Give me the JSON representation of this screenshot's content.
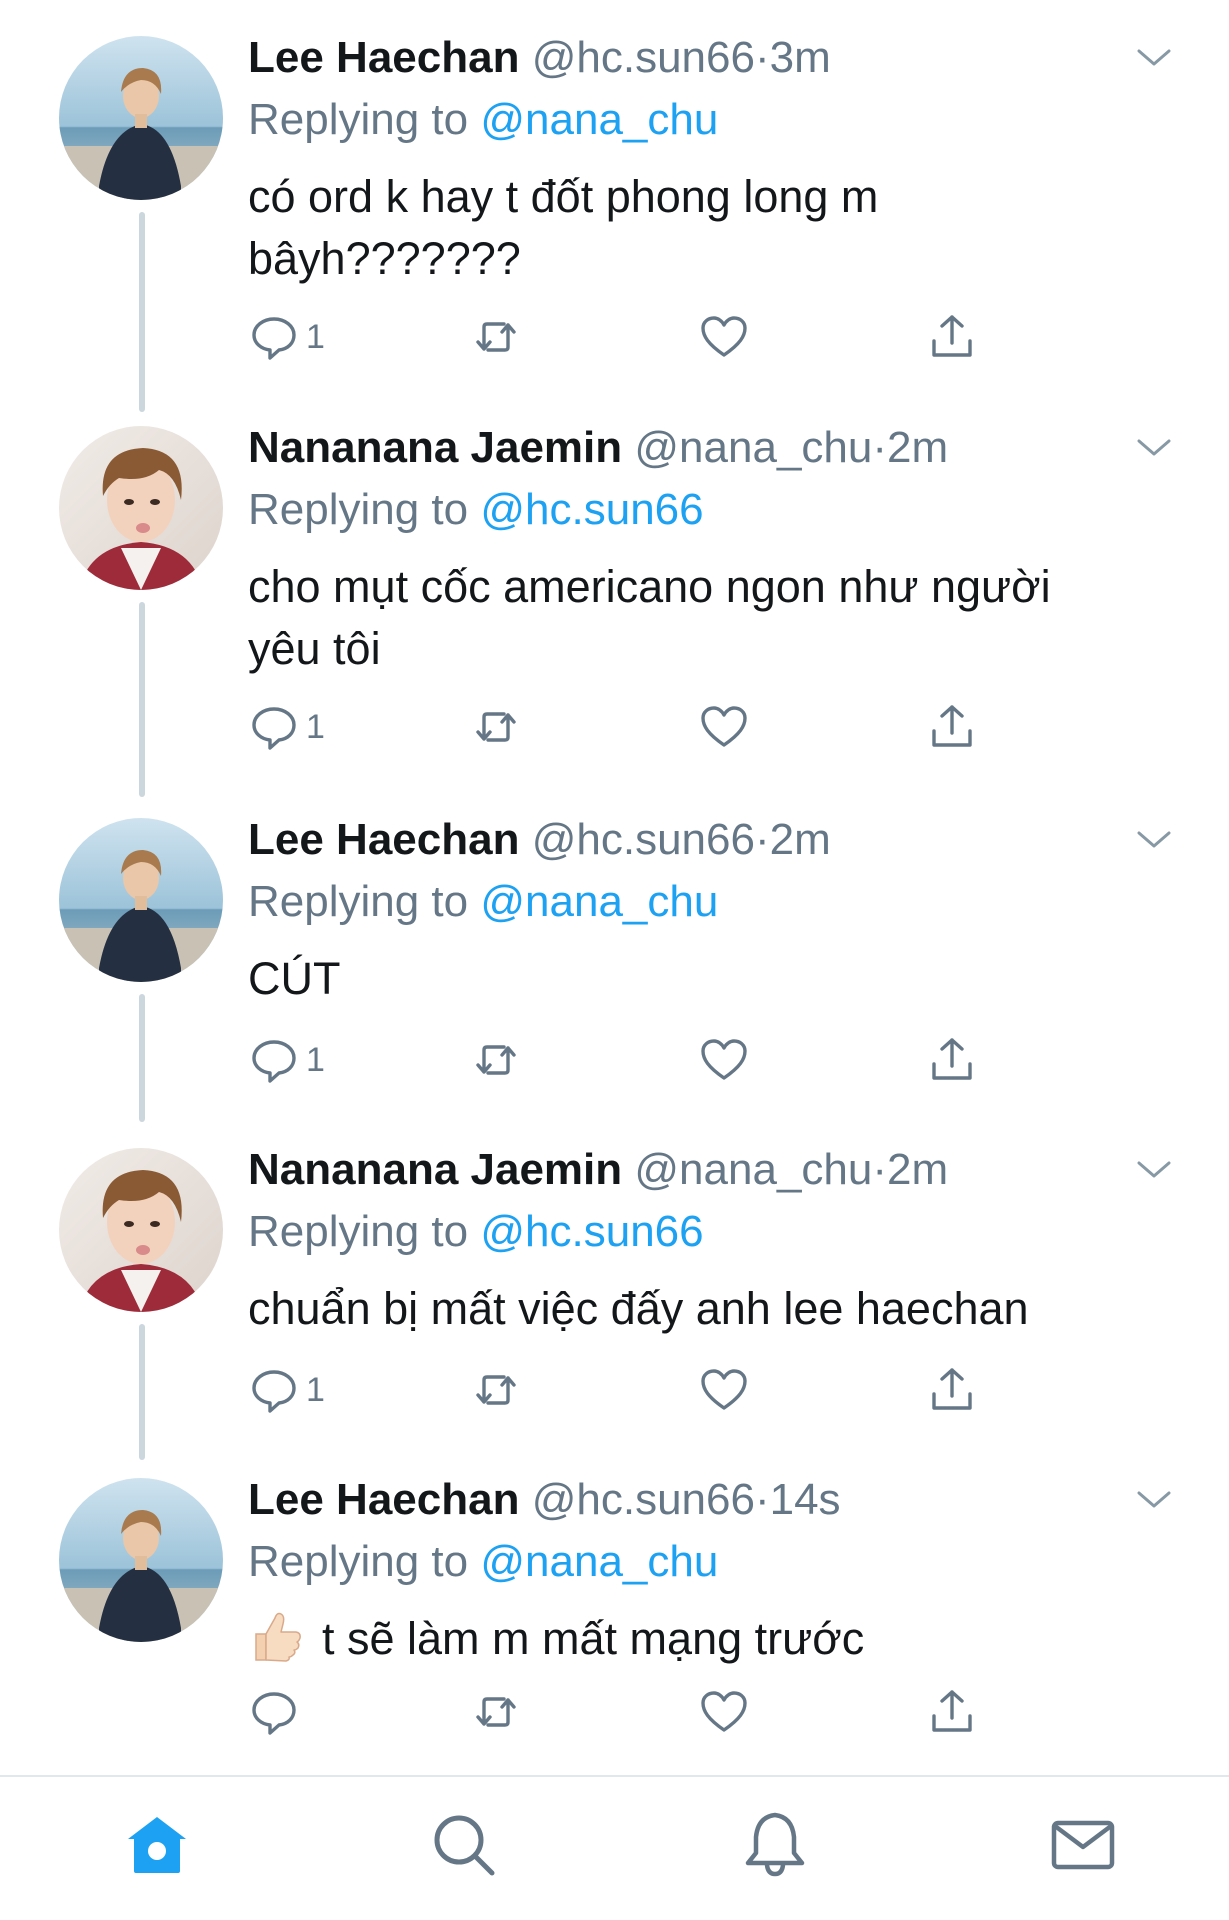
{
  "tweets": [
    {
      "name": "Lee Haechan",
      "handle": "@hc.sun66",
      "dot": "·",
      "time": "3m",
      "replying_prefix": "Replying to ",
      "replying_to": "@nana_chu",
      "text": "có ord k hay t đốt phong long m bâyh???????",
      "reply_count": "1",
      "avatar": "beach-sweater-avatar"
    },
    {
      "name": "Nananana Jaemin",
      "handle": "@nana_chu",
      "dot": "·",
      "time": "2m",
      "replying_prefix": "Replying to ",
      "replying_to": "@hc.sun66",
      "text": "cho mụt cốc americano ngon như người yêu tôi",
      "reply_count": "1",
      "avatar": "face-selfie-avatar"
    },
    {
      "name": "Lee Haechan",
      "handle": "@hc.sun66",
      "dot": "·",
      "time": "2m",
      "replying_prefix": "Replying to ",
      "replying_to": "@nana_chu",
      "text": "CÚT",
      "reply_count": "1",
      "avatar": "beach-sweater-avatar"
    },
    {
      "name": "Nananana Jaemin",
      "handle": "@nana_chu",
      "dot": "·",
      "time": "2m",
      "replying_prefix": "Replying to ",
      "replying_to": "@hc.sun66",
      "text": "chuẩn bị mất việc đấy anh lee haechan",
      "reply_count": "1",
      "avatar": "face-selfie-avatar"
    },
    {
      "name": "Lee Haechan",
      "handle": "@hc.sun66",
      "dot": "·",
      "time": "14s",
      "replying_prefix": "Replying to ",
      "replying_to": "@nana_chu",
      "text": "t sẽ làm m mất mạng trước",
      "reply_count": "",
      "avatar": "beach-sweater-avatar",
      "emoji": "thumbs-up-icon"
    }
  ],
  "icons": {
    "reply": "reply-icon",
    "retweet": "retweet-icon",
    "like": "heart-icon",
    "share": "share-icon",
    "more": "chevron-down-icon"
  },
  "tabbar": {
    "home": "home-icon",
    "search": "search-icon",
    "notifications": "bell-icon",
    "messages": "mail-icon",
    "active": "home"
  },
  "colors": {
    "accent": "#1da1f2",
    "secondary_text": "#657786",
    "thread_line": "#ccd6dd",
    "icon_gray": "#657786"
  }
}
